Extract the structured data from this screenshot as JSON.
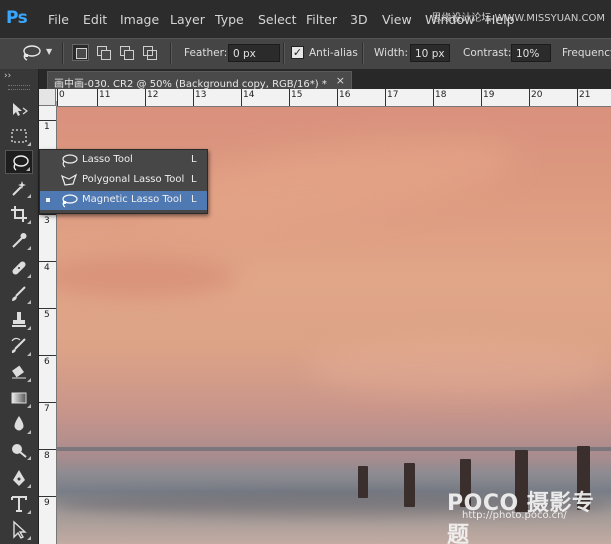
{
  "app": {
    "logo": "Ps",
    "menu": [
      "File",
      "Edit",
      "Image",
      "Layer",
      "Type",
      "Select",
      "Filter",
      "3D",
      "View",
      "Window",
      "Help"
    ],
    "watermark_top": "思缘设计论坛 WWW.MISSYUAN.COM"
  },
  "options_bar": {
    "tool_icon": "magnetic-lasso-icon",
    "selection_modes": [
      "new-selection",
      "add-to-selection",
      "subtract-from-selection",
      "intersect-selection"
    ],
    "feather_label": "Feather:",
    "feather_value": "0 px",
    "antialias_label": "Anti-alias",
    "antialias_checked": true,
    "width_label": "Width:",
    "width_value": "10 px",
    "contrast_label": "Contrast:",
    "contrast_value": "10%",
    "frequency_label": "Frequency"
  },
  "toolbar": {
    "collapse": "››",
    "tools": [
      "move-icon",
      "marquee-icon",
      "lasso-icon",
      "magic-wand-icon",
      "crop-icon",
      "eyedropper-icon",
      "healing-brush-icon",
      "brush-icon",
      "clone-stamp-icon",
      "history-brush-icon",
      "eraser-icon",
      "gradient-icon",
      "blur-icon",
      "dodge-icon",
      "pen-icon",
      "type-icon",
      "path-selection-icon"
    ]
  },
  "document": {
    "tab_title": "画中画-030. CR2 @ 50% (Background copy, RGB/16*) *",
    "close": "×"
  },
  "rulers": {
    "horizontal": [
      "0",
      "11",
      "12",
      "13",
      "14",
      "15",
      "16",
      "17",
      "18",
      "19",
      "20",
      "21"
    ],
    "vertical": [
      "1",
      "2",
      "3",
      "4",
      "5",
      "6",
      "7",
      "8",
      "9"
    ]
  },
  "flyout": {
    "items": [
      {
        "label": "Lasso Tool",
        "shortcut": "L",
        "icon": "lasso-icon",
        "selected": false
      },
      {
        "label": "Polygonal Lasso Tool",
        "shortcut": "L",
        "icon": "polygonal-lasso-icon",
        "selected": false
      },
      {
        "label": "Magnetic Lasso Tool",
        "shortcut": "L",
        "icon": "magnetic-lasso-icon",
        "selected": true
      }
    ]
  },
  "canvas_watermark": {
    "brand": "POCO 摄影专题",
    "url": "http://photo.poco.cn/"
  },
  "colors": {
    "menubar": "#2c2c2c",
    "options_bar": "#454545",
    "toolbar": "#383838",
    "flyout_selected": "#4f79b3",
    "ps_logo": "#39a7ff"
  }
}
